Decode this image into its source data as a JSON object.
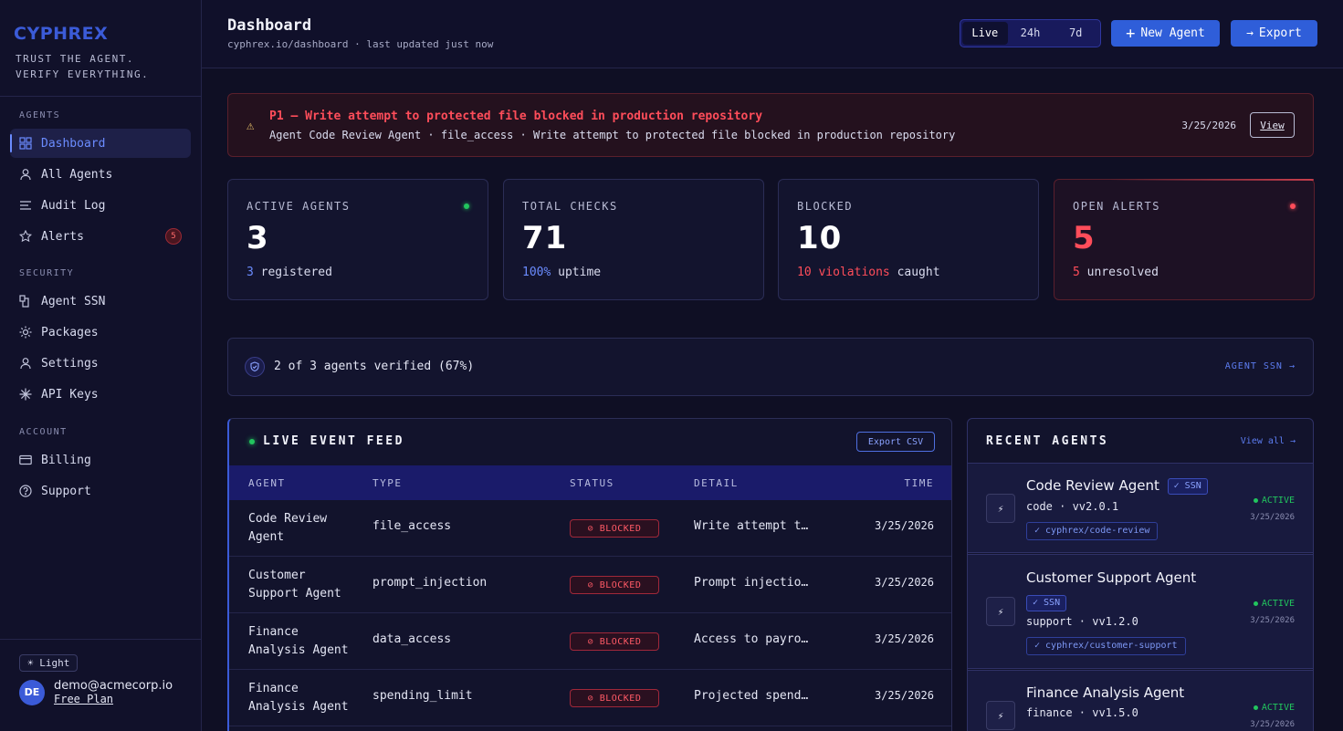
{
  "brand": {
    "logo": "CYPHREX",
    "tagline_1": "TRUST THE AGENT.",
    "tagline_2": "VERIFY EVERYTHING."
  },
  "sidebar": {
    "sections": {
      "agents": "AGENTS",
      "security": "SECURITY",
      "account": "ACCOUNT"
    },
    "items": [
      {
        "label": "Dashboard",
        "icon": "grid-icon",
        "active": true
      },
      {
        "label": "All Agents",
        "icon": "user-icon"
      },
      {
        "label": "Audit Log",
        "icon": "list-icon"
      },
      {
        "label": "Alerts",
        "icon": "star-icon",
        "badge": "5"
      },
      {
        "label": "Agent SSN",
        "icon": "id-icon"
      },
      {
        "label": "Packages",
        "icon": "sun-icon"
      },
      {
        "label": "Settings",
        "icon": "user-icon"
      },
      {
        "label": "API Keys",
        "icon": "asterisk-icon"
      },
      {
        "label": "Billing",
        "icon": "card-icon"
      },
      {
        "label": "Support",
        "icon": "help-icon"
      }
    ],
    "theme_toggle": "☀ Light",
    "user": {
      "initials": "DE",
      "email": "demo@acmecorp.io",
      "plan": "Free Plan"
    }
  },
  "header": {
    "title": "Dashboard",
    "subtitle": "cyphrex.io/dashboard · last updated just now",
    "ranges": [
      "Live",
      "24h",
      "7d"
    ],
    "new_agent": "New Agent",
    "export": "Export"
  },
  "alert": {
    "title": "P1 — Write attempt to protected file blocked in production repository",
    "detail": "Agent Code Review Agent · file_access · Write attempt to protected file blocked in production repository",
    "date": "3/25/2026",
    "view": "View"
  },
  "stats": [
    {
      "label": "ACTIVE AGENTS",
      "value": "3",
      "highlight": "3",
      "suffix": " registered"
    },
    {
      "label": "TOTAL CHECKS",
      "value": "71",
      "highlight": "100%",
      "suffix": " uptime"
    },
    {
      "label": "BLOCKED",
      "value": "10",
      "highlight": "10 violations",
      "suffix": " caught"
    },
    {
      "label": "OPEN ALERTS",
      "value": "5",
      "highlight": "5",
      "suffix": " unresolved"
    }
  ],
  "verify": {
    "text": "2 of 3 agents verified (67%)",
    "link": "AGENT SSN →"
  },
  "feed": {
    "title": "LIVE EVENT FEED",
    "export": "Export CSV",
    "columns": [
      "AGENT",
      "TYPE",
      "STATUS",
      "DETAIL",
      "TIME"
    ],
    "rows": [
      {
        "agent": "Code Review Agent",
        "type": "file_access",
        "status": "⊘ BLOCKED",
        "detail": "Write attempt t…",
        "time": "3/25/2026"
      },
      {
        "agent": "Customer Support Agent",
        "type": "prompt_injection",
        "status": "⊘ BLOCKED",
        "detail": "Prompt injectio…",
        "time": "3/25/2026"
      },
      {
        "agent": "Finance Analysis Agent",
        "type": "data_access",
        "status": "⊘ BLOCKED",
        "detail": "Access to payro…",
        "time": "3/25/2026"
      },
      {
        "agent": "Finance Analysis Agent",
        "type": "spending_limit",
        "status": "⊘ BLOCKED",
        "detail": "Projected spend…",
        "time": "3/25/2026"
      }
    ]
  },
  "recent": {
    "title": "RECENT AGENTS",
    "view_all": "View all →",
    "agents": [
      {
        "name": "Code Review Agent",
        "ssn": "✓ SSN",
        "sub": "code · vv2.0.1",
        "repo": "✓ cyphrex/code-review",
        "status": "ACTIVE",
        "date": "3/25/2026"
      },
      {
        "name": "Customer Support Agent",
        "ssn": "✓ SSN",
        "sub": "support · vv1.2.0",
        "repo": "✓ cyphrex/customer-support",
        "status": "ACTIVE",
        "date": "3/25/2026"
      },
      {
        "name": "Finance Analysis Agent",
        "sub": "finance · vv1.5.0",
        "status": "ACTIVE",
        "date": "3/25/2026"
      }
    ]
  },
  "colors": {
    "accent": "#3b5bd8",
    "danger": "#ff4d5a",
    "success": "#22c55e"
  }
}
